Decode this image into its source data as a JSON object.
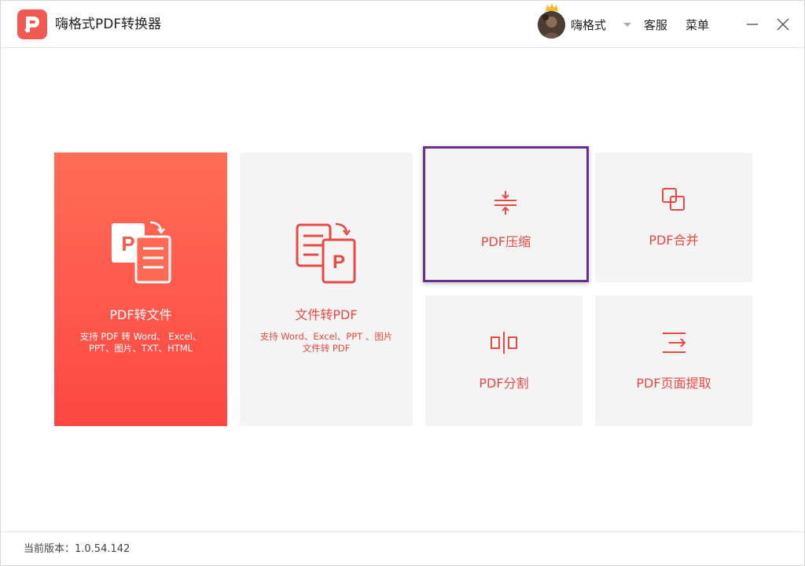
{
  "app": {
    "title": "嗨格式PDF转换器",
    "logo_icon": "pdf-logo-icon"
  },
  "header": {
    "user_name": "嗨格式",
    "service_label": "客服",
    "menu_label": "菜单",
    "minimize_icon": "minimize-icon",
    "close_icon": "close-icon"
  },
  "tiles": {
    "pdf_to_file": {
      "label": "PDF转文件",
      "desc": "支持 PDF 转 Word、 Excel、 PPT、图片、TXT、HTML",
      "icon": "pdf-to-file-icon"
    },
    "file_to_pdf": {
      "label": "文件转PDF",
      "desc": "支持 Word、Excel、PPT 、图片文件转 PDF",
      "icon": "file-to-pdf-icon"
    },
    "compress": {
      "label": "PDF压缩",
      "icon": "compress-icon"
    },
    "merge": {
      "label": "PDF合并",
      "icon": "merge-icon"
    },
    "split": {
      "label": "PDF分割",
      "icon": "split-icon"
    },
    "extract": {
      "label": "PDF页面提取",
      "icon": "extract-icon"
    }
  },
  "footer": {
    "version": "当前版本：1.0.54.142"
  },
  "colors": {
    "accent": "#e84a42",
    "primary_tile_top": "#ff6d57",
    "primary_tile_bottom": "#fd4743",
    "selection_border": "#6a2f8c"
  }
}
